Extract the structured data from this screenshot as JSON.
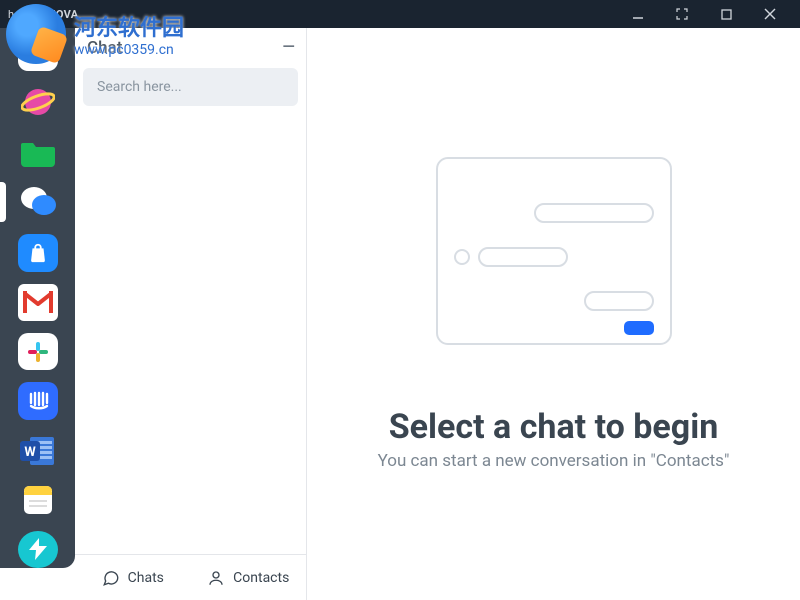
{
  "titlebar": {
    "brand_left": "horbito",
    "brand_right": "NOVA"
  },
  "panel": {
    "title": "Chat",
    "search_placeholder": "Search here...",
    "tab_chats": "Chats",
    "tab_contacts": "Contacts"
  },
  "main": {
    "title": "Select a chat to begin",
    "subtitle": "You can start a new conversation in \"Contacts\""
  },
  "sidebar": {
    "icons": [
      "refresh-icon",
      "planet-icon",
      "folder-icon",
      "messages-icon",
      "store-icon",
      "gmail-icon",
      "slack-icon",
      "intercom-icon",
      "word-icon",
      "notes-icon",
      "bolt-icon"
    ],
    "active_index": 3
  },
  "watermark": {
    "line1": "河东软件园",
    "line2": "www.pc0359.cn"
  }
}
